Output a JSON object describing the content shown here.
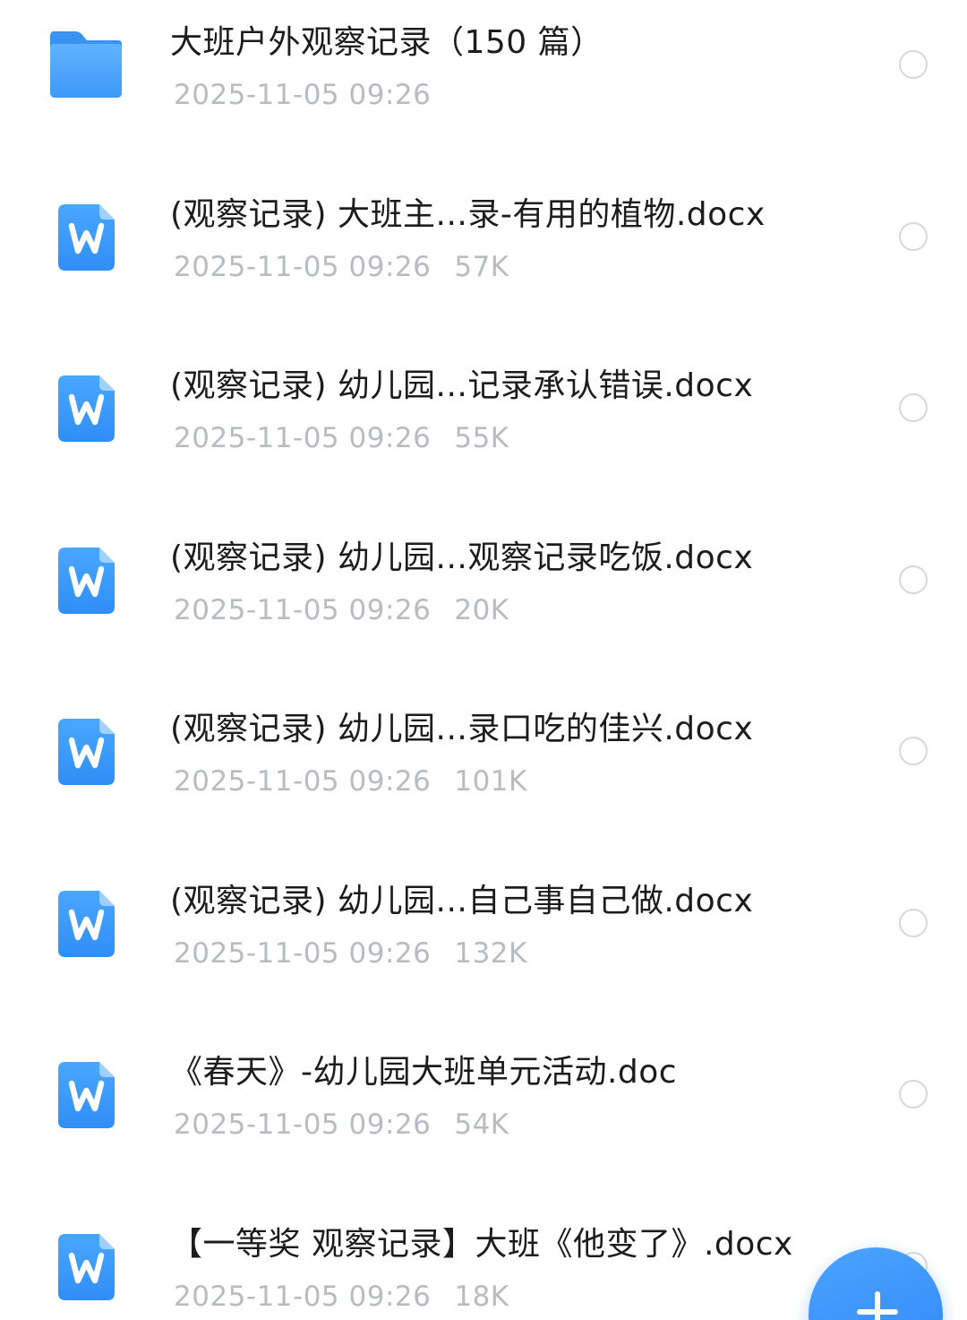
{
  "files": [
    {
      "kind": "folder",
      "icon": "folder-icon",
      "name": "大班户外观察记录（150 篇）",
      "date": "2025-11-05 09:26",
      "size": ""
    },
    {
      "kind": "doc",
      "icon": "word-doc-icon",
      "name": "(观察记录) 大班主...录-有用的植物.docx",
      "date": "2025-11-05 09:26",
      "size": "57K"
    },
    {
      "kind": "doc",
      "icon": "word-doc-icon",
      "name": "(观察记录) 幼儿园...记录承认错误.docx",
      "date": "2025-11-05 09:26",
      "size": "55K"
    },
    {
      "kind": "doc",
      "icon": "word-doc-icon",
      "name": "(观察记录) 幼儿园...观察记录吃饭.docx",
      "date": "2025-11-05 09:26",
      "size": "20K"
    },
    {
      "kind": "doc",
      "icon": "word-doc-icon",
      "name": "(观察记录) 幼儿园...录口吃的佳兴.docx",
      "date": "2025-11-05 09:26",
      "size": "101K"
    },
    {
      "kind": "doc",
      "icon": "word-doc-icon",
      "name": "(观察记录) 幼儿园...自己事自己做.docx",
      "date": "2025-11-05 09:26",
      "size": "132K"
    },
    {
      "kind": "doc",
      "icon": "word-doc-icon",
      "name": "《春天》-幼儿园大班单元活动.doc",
      "date": "2025-11-05 09:26",
      "size": "54K"
    },
    {
      "kind": "doc",
      "icon": "word-doc-icon",
      "name": "【一等奖 观察记录】大班《他变了》.docx",
      "date": "2025-11-05 09:26",
      "size": "18K"
    }
  ],
  "fab": {
    "icon": "plus-icon"
  },
  "colors": {
    "accent": "#2f86f6",
    "folder": "#4ea8ff",
    "doc": "#3d9cff",
    "title_text": "#1c1c1e",
    "meta_text": "#b8bbc2",
    "radio_border": "#d6d8dc"
  }
}
